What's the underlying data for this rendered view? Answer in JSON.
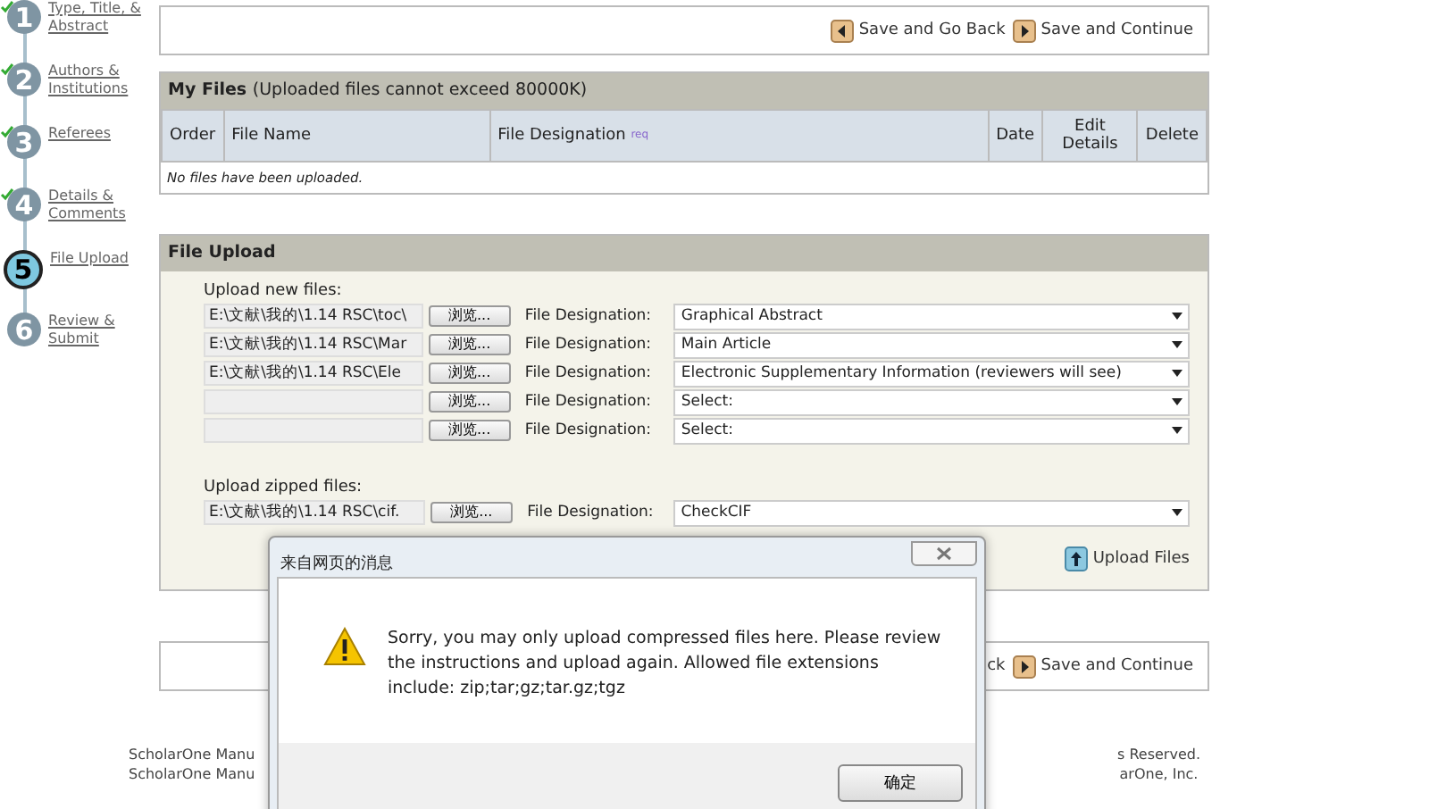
{
  "steps": [
    {
      "number": "1",
      "label": "Type, Title, & Abstract",
      "completed": true,
      "selected": false
    },
    {
      "number": "2",
      "label": "Authors & Institutions",
      "completed": true,
      "selected": false
    },
    {
      "number": "3",
      "label": "Referees",
      "completed": true,
      "selected": false
    },
    {
      "number": "4",
      "label": "Details & Comments",
      "completed": true,
      "selected": false
    },
    {
      "number": "5",
      "label": "File Upload",
      "completed": false,
      "selected": true
    },
    {
      "number": "6",
      "label": "Review & Submit",
      "completed": false,
      "selected": false
    }
  ],
  "top_nav": {
    "back": "Save and Go Back",
    "continue": "Save and Continue"
  },
  "my_files": {
    "title": "My Files",
    "note": "(Uploaded files cannot exceed 80000K)",
    "columns": [
      "Order",
      "File Name",
      "File Designation",
      "Date",
      "Edit Details",
      "Delete"
    ],
    "req_mark": "req",
    "empty": "No files have been uploaded."
  },
  "file_upload": {
    "title": "File Upload",
    "new_label": "Upload new files:",
    "rows": [
      {
        "path": "E:\\文献\\我的\\1.14 RSC\\toc\\",
        "browse": "浏览...",
        "designation_label": "File Designation:",
        "designation": "Graphical Abstract"
      },
      {
        "path": "E:\\文献\\我的\\1.14 RSC\\Mar",
        "browse": "浏览...",
        "designation_label": "File Designation:",
        "designation": "Main Article"
      },
      {
        "path": "E:\\文献\\我的\\1.14 RSC\\Ele",
        "browse": "浏览...",
        "designation_label": "File Designation:",
        "designation": "Electronic Supplementary Information (reviewers will see)"
      },
      {
        "browse": "浏览...",
        "designation_label": "File Designation:",
        "designation": "Select:"
      },
      {
        "browse": "浏览...",
        "designation_label": "File Designation:",
        "designation": "Select:"
      }
    ],
    "zipped_label": "Upload zipped files:",
    "zipped": {
      "path": "E:\\文献\\我的\\1.14 RSC\\cif.",
      "browse": "浏览...",
      "designation_label": "File Designation:",
      "designation": "CheckCIF"
    },
    "upload_button": "Upload Files"
  },
  "bottom_nav": {
    "back": "ck",
    "continue": "Save and Continue"
  },
  "footer": {
    "left": [
      "ScholarOne Manu",
      "ScholarOne Manu"
    ],
    "right": [
      "s Reserved.",
      "arOne, Inc."
    ]
  },
  "dialog": {
    "title": "来自网页的消息",
    "message": "Sorry, you may only upload compressed files here. Please review the instructions and upload again. Allowed file extensions include: zip;tar;gz;tar.gz;tgz",
    "ok": "确定"
  }
}
